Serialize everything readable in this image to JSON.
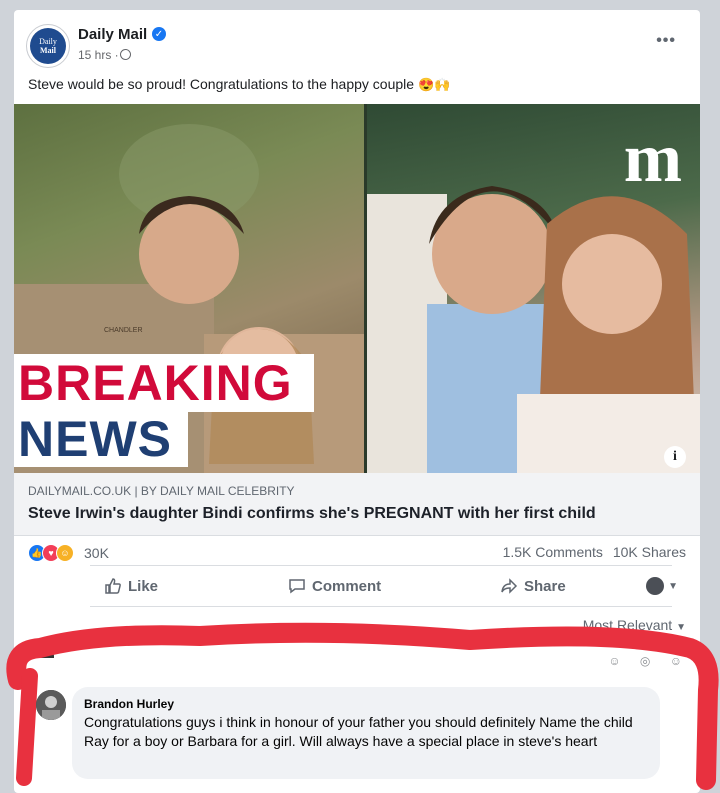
{
  "post": {
    "page_name": "Daily Mail",
    "logo_text_top": "Daily",
    "logo_text_bottom": "Mail",
    "time": "15 hrs ·",
    "text": "Steve would be so proud! Congratulations to the happy couple",
    "text_emoji": "😍🙌",
    "more_label": "•••"
  },
  "image": {
    "banner_top": "BREAKING",
    "banner_bottom": "NEWS",
    "brand_mark": "m",
    "info_label": "i",
    "shirt_label": "CHANDLER"
  },
  "link": {
    "domain": "DAILYMAIL.CO.UK | BY DAILY MAIL CELEBRITY",
    "title": "Steve Irwin's daughter Bindi confirms she's PREGNANT with her first child"
  },
  "engagement": {
    "reaction_count": "30K",
    "comments": "1.5K Comments",
    "shares": "10K Shares"
  },
  "actions": {
    "like": "Like",
    "comment": "Comment",
    "share": "Share"
  },
  "comments": {
    "sort_label": "Most Relevant",
    "items": [
      {
        "author": "Brandon Hurley",
        "text": "Congratulations guys i think in honour of your father you should definitely Name the child Ray for a boy or Barbara for a girl. Will always have a special place in steve's heart"
      }
    ]
  },
  "colors": {
    "facebook_blue": "#1877f2",
    "highlight_red": "#e8313f",
    "breaking_red": "#d10a3a",
    "news_blue": "#1f3f73"
  }
}
